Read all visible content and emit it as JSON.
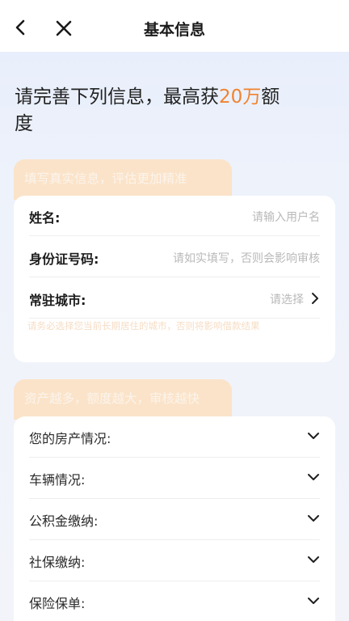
{
  "nav": {
    "title": "基本信息"
  },
  "headline": {
    "prefix": "请完善下列信息，最高获",
    "amount": "20万",
    "suffix": "额度"
  },
  "section1": {
    "tag": "填写真实信息，评估更加精准",
    "fields": [
      {
        "label": "姓名:",
        "placeholder": "请输入用户名"
      },
      {
        "label": "身份证号码:",
        "placeholder": "请如实填写，否则会影响审核"
      },
      {
        "label": "常驻城市:",
        "placeholder": "请选择"
      }
    ],
    "note": "请务必选择您当前长期居住的城市，否则将影响借款结果"
  },
  "section2": {
    "tag": "资产越多，额度越大，审核越快",
    "items": [
      {
        "label": "您的房产情况:"
      },
      {
        "label": "车辆情况:"
      },
      {
        "label": "公积金缴纳:"
      },
      {
        "label": "社保缴纳:"
      },
      {
        "label": "保险保单:"
      }
    ]
  },
  "colors": {
    "accent": "#f0822f",
    "tag_bg": "#fbe3c9"
  }
}
